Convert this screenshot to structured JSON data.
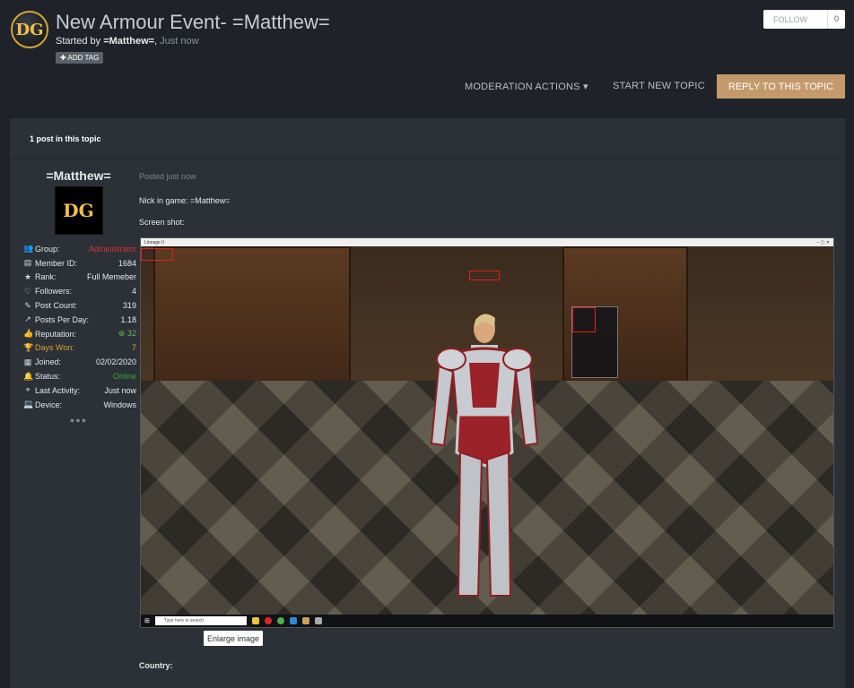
{
  "header": {
    "logo_text": "DG",
    "title": "New Armour Event- =Matthew=",
    "started_prefix": "Started by ",
    "started_by": "=Matthew=",
    "started_sep": ", ",
    "started_time": "Just now",
    "add_tag": "ADD TAG",
    "follow_label": "FOLLOW",
    "follow_count": "0"
  },
  "actions": {
    "moderation": "MODERATION ACTIONS",
    "start_new": "START NEW TOPIC",
    "reply": "REPLY TO THIS TOPIC"
  },
  "topic": {
    "post_count_label": "1 post in this topic"
  },
  "author": {
    "name": "=Matthew=",
    "avatar_text": "DG",
    "stats": [
      {
        "icon": "group-icon",
        "glyph": "👥",
        "label": "Group:",
        "value": "Administrator",
        "style": "red"
      },
      {
        "icon": "id-card-icon",
        "glyph": "▤",
        "label": "Member ID:",
        "value": "1684",
        "style": ""
      },
      {
        "icon": "star-icon",
        "glyph": "★",
        "label": "Rank:",
        "value": "Full Memeber",
        "style": ""
      },
      {
        "icon": "heart-icon",
        "glyph": "♡",
        "label": "Followers:",
        "value": "4",
        "style": ""
      },
      {
        "icon": "edit-icon",
        "glyph": "✎",
        "label": "Post Count:",
        "value": "319",
        "style": ""
      },
      {
        "icon": "chart-icon",
        "glyph": "↗",
        "label": "Posts Per Day:",
        "value": "1.18",
        "style": ""
      },
      {
        "icon": "thumbs-up-icon",
        "glyph": "👍",
        "label": "Reputation:",
        "value": "32",
        "style": "rep"
      },
      {
        "icon": "trophy-icon",
        "glyph": "🏆",
        "label": "Days Won:",
        "value": "7",
        "style": "gold"
      },
      {
        "icon": "calendar-icon",
        "glyph": "▦",
        "label": "Joined:",
        "value": "02/02/2020",
        "style": ""
      },
      {
        "icon": "bell-icon",
        "glyph": "🔔",
        "label": "Status:",
        "value": "Online",
        "style": "green"
      },
      {
        "icon": "location-icon",
        "glyph": "⌖",
        "label": "Last Activity:",
        "value": "Just now",
        "style": ""
      },
      {
        "icon": "laptop-icon",
        "glyph": "💻",
        "label": "Device:",
        "value": "Windows",
        "style": ""
      }
    ]
  },
  "post": {
    "posted": "Posted just now",
    "nick_line": "Nick in game: =Matthew=",
    "screenshot_line": "Screen shot:",
    "enlarge": "Enlarge image",
    "country_label": "Country:"
  },
  "screenshot": {
    "window_title": "Lineage II",
    "taskbar_search": "Type here to search"
  }
}
